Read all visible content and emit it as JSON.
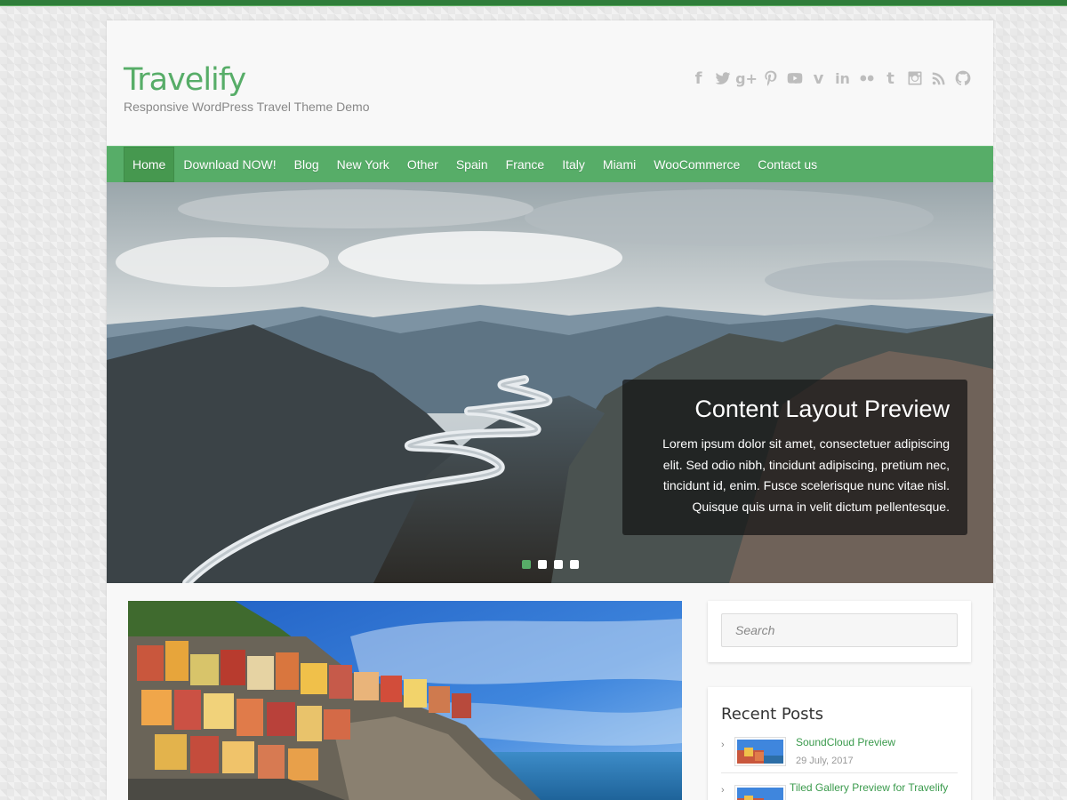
{
  "site": {
    "title": "Travelify",
    "description": "Responsive WordPress Travel Theme Demo"
  },
  "social_icons": [
    "facebook-icon",
    "twitter-icon",
    "google-plus-icon",
    "pinterest-icon",
    "youtube-icon",
    "vimeo-icon",
    "linkedin-icon",
    "flickr-icon",
    "tumblr-icon",
    "instagram-icon",
    "rss-icon",
    "github-icon"
  ],
  "nav": {
    "items": [
      {
        "label": "Home"
      },
      {
        "label": "Download NOW!"
      },
      {
        "label": "Blog"
      },
      {
        "label": "New York"
      },
      {
        "label": "Other"
      },
      {
        "label": "Spain"
      },
      {
        "label": "France"
      },
      {
        "label": "Italy"
      },
      {
        "label": "Miami"
      },
      {
        "label": "WooCommerce"
      },
      {
        "label": "Contact us"
      }
    ],
    "active_index": 0
  },
  "slider": {
    "caption_title": "Content Layout Preview",
    "caption_text": "Lorem ipsum dolor sit amet, consectetuer adipiscing elit. Sed odio nibh, tincidunt adipiscing, pretium nec, tincidunt id, enim. Fusce scelerisque nunc vitae nisl. Quisque quis urna in velit dictum pellentesque.",
    "slide_count": 4,
    "active_slide": 1
  },
  "search": {
    "placeholder": "Search"
  },
  "recent_posts": {
    "title": "Recent Posts",
    "items": [
      {
        "title": "SoundCloud Preview",
        "date": "29 July, 2017"
      },
      {
        "title": "Tiled Gallery Preview for Travelify"
      }
    ]
  },
  "colors": {
    "accent": "#57ad68",
    "top_bar": "#2f7d3a",
    "link": "#3a9a4c"
  }
}
